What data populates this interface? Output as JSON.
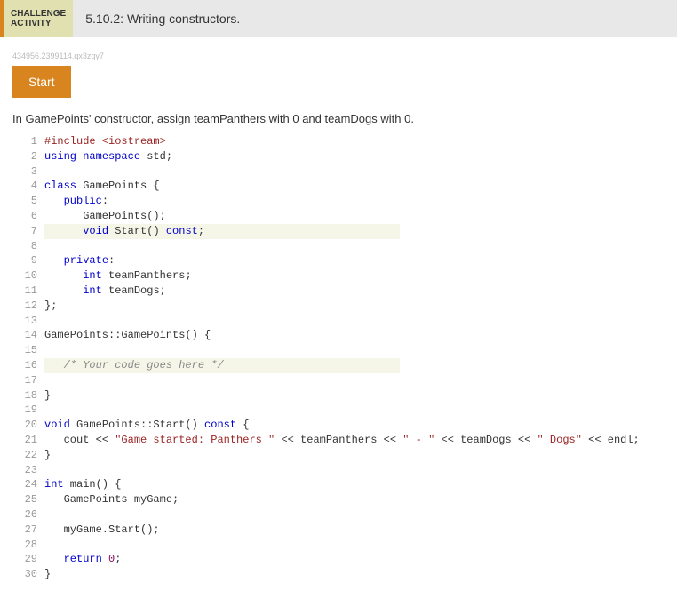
{
  "header": {
    "challenge_label_line1": "CHALLENGE",
    "challenge_label_line2": "ACTIVITY",
    "title": "5.10.2: Writing constructors."
  },
  "hash": "434956.2399114.qx3zqy7",
  "start_button": "Start",
  "instruction": "In GamePoints' constructor, assign teamPanthers with 0 and teamDogs with 0.",
  "code": {
    "l1_preproc": "#include <iostream>",
    "l2_kw1": "using",
    "l2_kw2": "namespace",
    "l2_ident": " std;",
    "l3": "",
    "l4_kw": "class",
    "l4_rest": " GamePoints {",
    "l5_pad": "   ",
    "l5_kw": "public",
    "l5_colon": ":",
    "l6": "      GamePoints();",
    "l7_pad": "      ",
    "l7_kw": "void",
    "l7_rest": " Start() ",
    "l7_kw2": "const",
    "l7_semi": ";",
    "l8": "",
    "l9_pad": "   ",
    "l9_kw": "private",
    "l9_colon": ":",
    "l10_pad": "      ",
    "l10_kw": "int",
    "l10_rest": " teamPanthers;",
    "l11_pad": "      ",
    "l11_kw": "int",
    "l11_rest": " teamDogs;",
    "l12": "};",
    "l13": "",
    "l14": "GamePoints::GamePoints() {",
    "l15": "",
    "l16_pad": "   ",
    "l16_comment": "/* Your code goes here */",
    "l17": "",
    "l18": "}",
    "l19": "",
    "l20_kw": "void",
    "l20_mid": " GamePoints::Start() ",
    "l20_kw2": "const",
    "l20_rest": " {",
    "l21_pad": "   cout << ",
    "l21_str1": "\"Game started: Panthers \"",
    "l21_mid1": " << teamPanthers << ",
    "l21_str2": "\" - \"",
    "l21_mid2": " << teamDogs << ",
    "l21_str3": "\" Dogs\"",
    "l21_end": " << endl;",
    "l22": "}",
    "l23": "",
    "l24_kw": "int",
    "l24_rest": " main() {",
    "l25": "   GamePoints myGame;",
    "l26": "",
    "l27": "   myGame.Start();",
    "l28": "",
    "l29_pad": "   ",
    "l29_kw": "return",
    "l29_sp": " ",
    "l29_num": "0",
    "l29_semi": ";",
    "l30": "}"
  },
  "line_numbers": [
    "1",
    "2",
    "3",
    "4",
    "5",
    "6",
    "7",
    "8",
    "9",
    "10",
    "11",
    "12",
    "13",
    "14",
    "15",
    "16",
    "17",
    "18",
    "19",
    "20",
    "21",
    "22",
    "23",
    "24",
    "25",
    "26",
    "27",
    "28",
    "29",
    "30"
  ]
}
